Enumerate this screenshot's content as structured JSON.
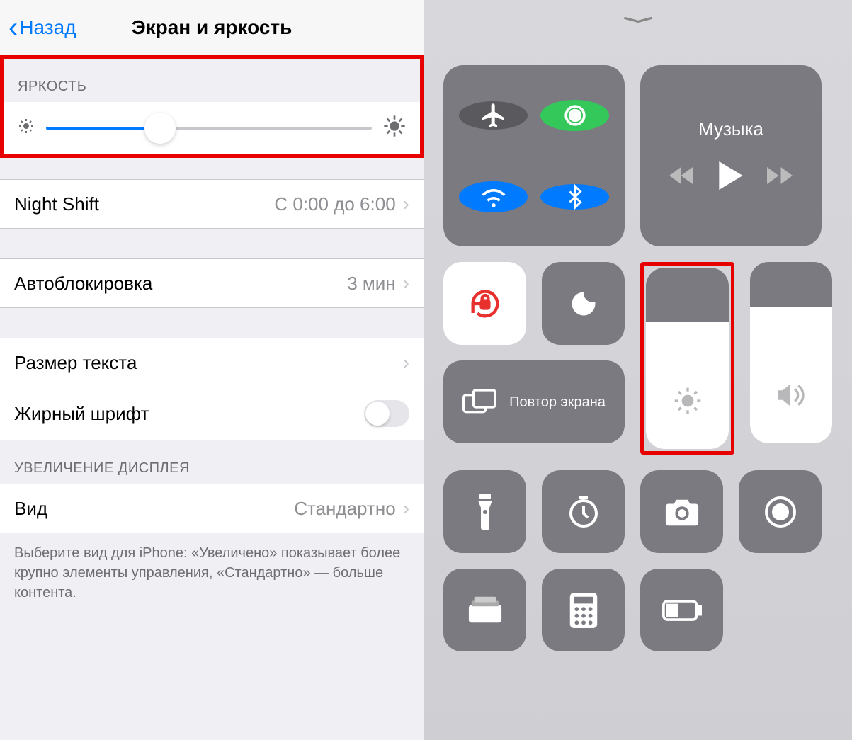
{
  "left": {
    "back_label": "Назад",
    "title": "Экран и яркость",
    "brightness_header": "ЯРКОСТЬ",
    "brightness_value": 35,
    "night_shift_label": "Night Shift",
    "night_shift_value": "С 0:00 до 6:00",
    "autolock_label": "Автоблокировка",
    "autolock_value": "3 мин",
    "text_size_label": "Размер текста",
    "bold_text_label": "Жирный шрифт",
    "bold_text_on": false,
    "display_zoom_header": "УВЕЛИЧЕНИЕ ДИСПЛЕЯ",
    "view_label": "Вид",
    "view_value": "Стандартно",
    "footer_text": "Выберите вид для iPhone: «Увеличено» показывает более крупно элементы управления, «Стандартно» — больше контента."
  },
  "right": {
    "media_title": "Музыка",
    "mirror_label": "Повтор экрана",
    "brightness_fill": 70,
    "volume_fill": 75
  }
}
